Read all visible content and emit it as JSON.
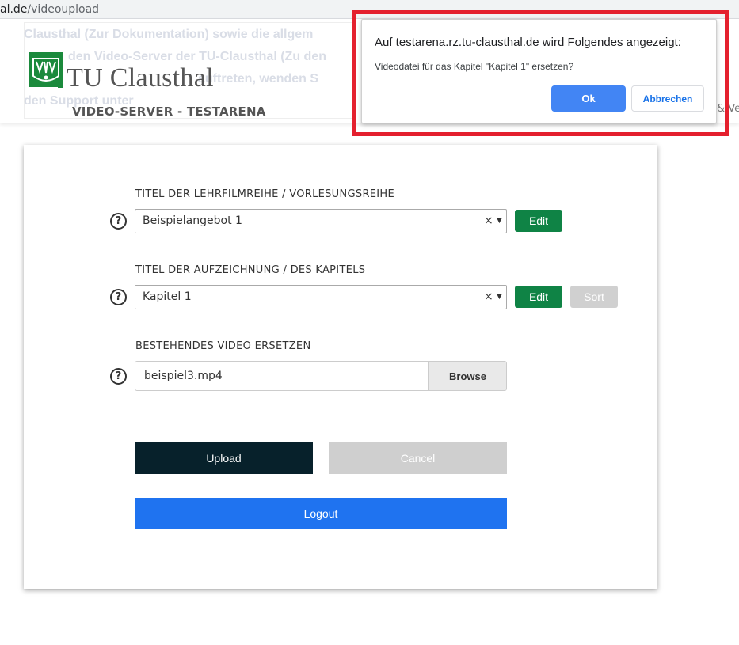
{
  "browser": {
    "url_host": "al.de",
    "url_path": "/videoupload"
  },
  "header": {
    "background_text": [
      "Clausthal (Zur Dokumentation) sowie die allgem",
      "den Video-Server der TU-Clausthal (Zu den",
      "auftreten, wenden S",
      "den Support unter"
    ],
    "brand": "TU Clausthal",
    "subbrand": "VIDEO-SERVER - TESTARENA",
    "right_fragment": "& Ve"
  },
  "dialog": {
    "title": "Auf testarena.rz.tu-clausthal.de wird Folgendes angezeigt:",
    "message": "Videodatei für das Kapitel \"Kapitel 1\" ersetzen?",
    "ok_label": "Ok",
    "cancel_label": "Abbrechen",
    "highlight_color": "#e4202e"
  },
  "form": {
    "series": {
      "label": "TITEL DER LEHRFILMREIHE / VORLESUNGSREIHE",
      "value": "Beispielangebot 1",
      "edit_label": "Edit"
    },
    "chapter": {
      "label": "TITEL DER AUFZEICHNUNG / DES KAPITELS",
      "value": "Kapitel 1",
      "edit_label": "Edit",
      "sort_label": "Sort"
    },
    "video": {
      "label": "BESTEHENDES VIDEO ERSETZEN",
      "filename": "beispiel3.mp4",
      "browse_label": "Browse"
    },
    "help_glyph": "?",
    "clear_glyph": "×",
    "arrow_glyph": "▼",
    "upload_label": "Upload",
    "cancel_label": "Cancel",
    "logout_label": "Logout"
  },
  "colors": {
    "brand_green": "#1b8a3c",
    "edit_green": "#0f8345",
    "upload_dark": "#07212b",
    "logout_blue": "#1f73f0",
    "dialog_ok_blue": "#4285f4"
  }
}
